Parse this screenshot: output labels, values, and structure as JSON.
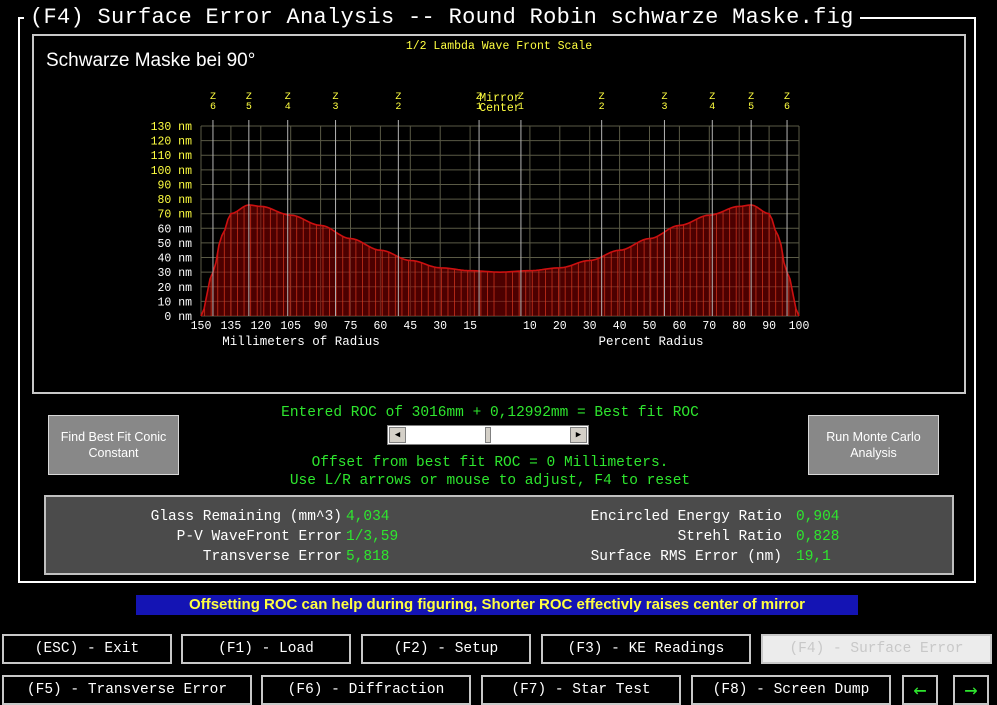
{
  "window": {
    "title": "(F4) Surface Error Analysis -- Round Robin schwarze Maske.fig"
  },
  "chart": {
    "heading": "Schwarze Maske bei 90°",
    "scale_label": "1/2 Lambda Wave Front Scale",
    "mirror_center_label_line1": "Mirror",
    "mirror_center_label_line2": "Center",
    "x_label_left": "Millimeters of Radius",
    "x_label_right": "Percent Radius"
  },
  "chart_data": {
    "type": "area",
    "title": "Schwarze Maske bei 90°",
    "subtitle": "1/2 Lambda Wave Front Scale",
    "y_unit": "nm",
    "y_ticks": [
      0,
      10,
      20,
      30,
      40,
      50,
      60,
      70,
      80,
      90,
      100,
      110,
      120,
      130
    ],
    "ylim": [
      0,
      130
    ],
    "y_highlight_ticks": [
      70,
      80,
      90,
      100,
      110,
      120,
      130
    ],
    "left_axis": {
      "xlabel": "Millimeters of Radius",
      "ticks": [
        "150",
        "135",
        "120",
        "105",
        "90",
        "75",
        "60",
        "45",
        "30",
        "15"
      ]
    },
    "right_axis": {
      "xlabel": "Percent Radius",
      "ticks": [
        "10",
        "20",
        "30",
        "40",
        "50",
        "60",
        "70",
        "80",
        "90",
        "100"
      ]
    },
    "zones_left": [
      "Z6",
      "Z5",
      "Z4",
      "Z3",
      "Z2",
      "Z1"
    ],
    "zones_right": [
      "Z1",
      "Z2",
      "Z3",
      "Z4",
      "Z5",
      "Z6"
    ],
    "series": [
      {
        "x_percent_radius": [
          0,
          10,
          20,
          30,
          40,
          50,
          60,
          70,
          80,
          84,
          90,
          93,
          96,
          100
        ],
        "y_nm": [
          30,
          31,
          33,
          38,
          45,
          53,
          62,
          69,
          75,
          76,
          70,
          55,
          30,
          0
        ]
      }
    ],
    "grid": true,
    "colors": {
      "curve": "#cc1010",
      "fill": "#8b0000",
      "grid": "#5a5a46",
      "yellow": "#ffff40"
    }
  },
  "roc": {
    "entered_line": "Entered ROC of 3016mm + 0,12992mm = Best fit ROC",
    "offset_line": "Offset from best fit ROC = 0 Millimeters.",
    "hint_line": "Use L/R arrows or mouse to adjust, F4 to reset",
    "slider_position": 0.5
  },
  "buttons": {
    "best_fit_conic": "Find Best Fit Conic Constant",
    "monte_carlo": "Run Monte Carlo Analysis"
  },
  "stats": {
    "glass_remaining_label": "Glass Remaining (mm^3)",
    "glass_remaining": "4,034",
    "pv_label": "P-V WaveFront Error",
    "pv": "1/3,59",
    "transverse_label": "Transverse Error",
    "transverse": "5,818",
    "encircled_label": "Encircled Energy Ratio",
    "encircled": "0,904",
    "strehl_label": "Strehl Ratio",
    "strehl": "0,828",
    "rms_label": "Surface RMS Error (nm)",
    "rms": "19,1"
  },
  "tip": "Offsetting ROC can help during figuring, Shorter ROC effectivly raises center of mirror",
  "fkeys": {
    "esc": "(ESC) - Exit",
    "f1": "(F1) - Load",
    "f2": "(F2) - Setup",
    "f3": "(F3) - KE Readings",
    "f4": "(F4) - Surface Error",
    "f5": "(F5) - Transverse Error",
    "f6": "(F6) - Diffraction",
    "f7": "(F7) - Star Test",
    "f8": "(F8) - Screen Dump",
    "prev": "←",
    "next": "→"
  },
  "icons": {
    "scroll_left": "left-arrow-icon",
    "scroll_right": "right-arrow-icon"
  }
}
